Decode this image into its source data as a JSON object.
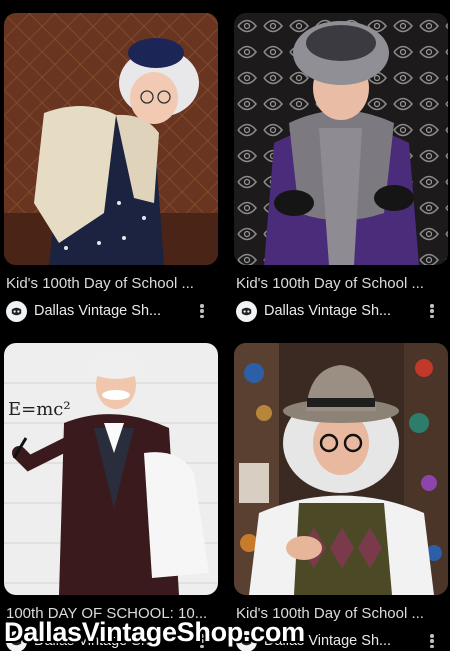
{
  "results": [
    {
      "title": "Kid's 100th Day of School ...",
      "source": "Dallas Vintage Sh...",
      "image": "girl-in-granny-costume-with-navy-hat"
    },
    {
      "title": "Kid's 100th Day of School ...",
      "source": "Dallas Vintage Sh...",
      "image": "girl-in-purple-dress-with-fur-hat"
    },
    {
      "title": "100th DAY OF SCHOOL: 10...",
      "source": "Dallas Vintage Sh...",
      "image": "boy-as-einstein-with-chalk"
    },
    {
      "title": "Kid's 100th Day of School ...",
      "source": "Dallas Vintage Sh...",
      "image": "boy-in-fedora-with-argyle-vest"
    }
  ],
  "watermark": "DallasVintageShop.com",
  "icons": {
    "favicon": "dallas-vintage-shop-logo-icon",
    "overflow": "more-vert-icon"
  },
  "colors": {
    "background": "#000000",
    "title": "#dadce0",
    "source": "#e8eaed"
  }
}
